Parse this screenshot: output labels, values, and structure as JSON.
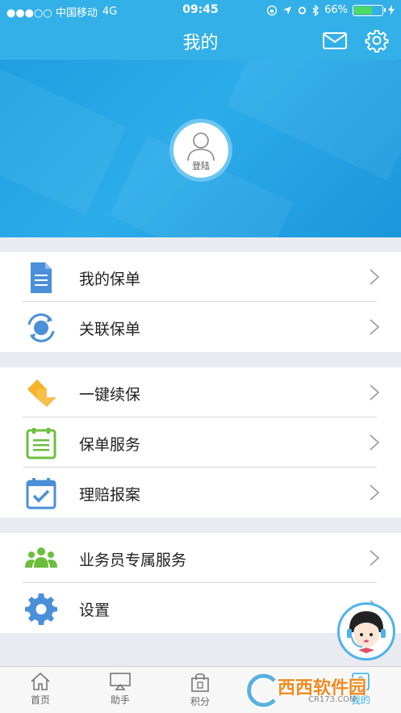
{
  "status_bar": {
    "carrier": "●●●○○ 中国移动",
    "network": "4G",
    "time": "09:45",
    "battery": "66%",
    "battery_level": 0.66
  },
  "nav": {
    "title": "我的",
    "mail_icon": "mail-icon",
    "settings_icon": "gear-icon"
  },
  "profile": {
    "login_label": "登陆"
  },
  "menu_groups": [
    [
      {
        "label": "我的保单",
        "icon": "document-icon"
      },
      {
        "label": "关联保单",
        "icon": "sync-icon"
      }
    ],
    [
      {
        "label": "一键续保",
        "icon": "renew-icon"
      },
      {
        "label": "保单服务",
        "icon": "clipboard-icon"
      },
      {
        "label": "理赔报案",
        "icon": "calendar-check-icon"
      }
    ],
    [
      {
        "label": "业务员专属服务",
        "icon": "people-icon"
      },
      {
        "label": "设置",
        "icon": "gear-icon"
      }
    ]
  ],
  "tabs": [
    {
      "label": "首页",
      "icon": "home-icon"
    },
    {
      "label": "助手",
      "icon": "monitor-icon"
    },
    {
      "label": "积分",
      "icon": "shopping-bag-icon"
    },
    {
      "label": "我的",
      "icon": "user-icon"
    }
  ],
  "watermark": {
    "text": "西西软件园",
    "sub": "CR173.COM"
  },
  "colors": {
    "primary": "#34b0e8",
    "hero": "#1f9fe0",
    "icon_blue": "#4a8fd8",
    "icon_yellow": "#f5b32a",
    "icon_green": "#6cbf3d"
  }
}
